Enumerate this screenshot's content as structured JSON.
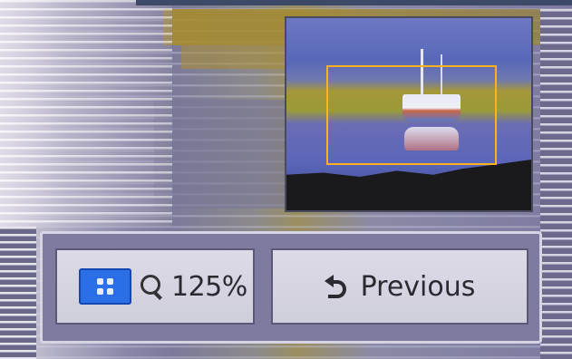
{
  "zoom_view": {
    "zoom_level": "125%",
    "grid_icon": "grid-icon",
    "zoom_icon": "magnifier-icon"
  },
  "navigator": {
    "viewport_color": "#ffb21e"
  },
  "controls": {
    "previous_label": "Previous",
    "previous_icon": "back-arrow-icon",
    "accent_color": "#2a6fe6"
  }
}
